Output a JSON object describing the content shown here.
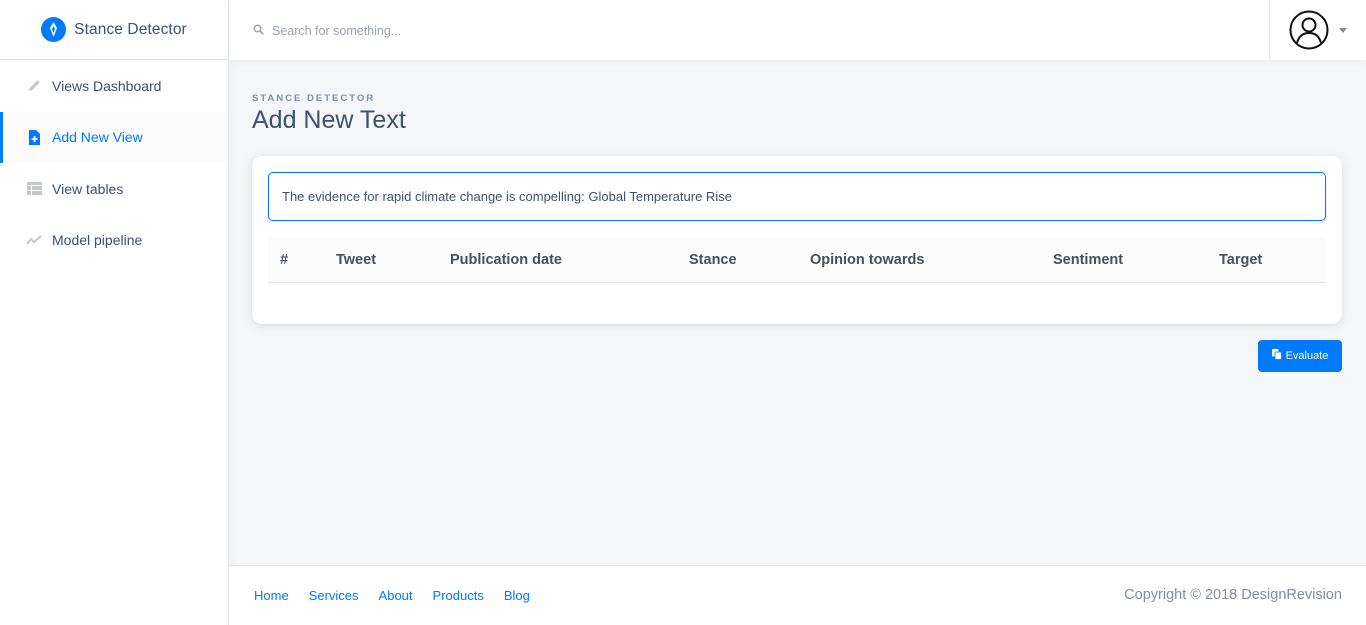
{
  "brand": {
    "name": "Stance Detector",
    "logo_icon": "flame-icon",
    "color": "#007bff"
  },
  "sidebar": {
    "items": [
      {
        "label": "Views Dashboard",
        "icon": "pencil-icon",
        "active": false
      },
      {
        "label": "Add New View",
        "icon": "note-add-icon",
        "active": true
      },
      {
        "label": "View tables",
        "icon": "table-icon",
        "active": false
      },
      {
        "label": "Model pipeline",
        "icon": "chart-line-icon",
        "active": false
      }
    ]
  },
  "topbar": {
    "search": {
      "placeholder": "Search for something...",
      "value": ""
    },
    "user": {
      "avatar_icon": "user-avatar-icon",
      "dropdown_icon": "caret-down-icon"
    }
  },
  "page": {
    "subtitle": "Stance Detector",
    "title": "Add New Text"
  },
  "editor": {
    "text_value": "The evidence for rapid climate change is compelling: Global Temperature Rise"
  },
  "table": {
    "columns": [
      "#",
      "Tweet",
      "Publication date",
      "Stance",
      "Opinion towards",
      "Sentiment",
      "Target"
    ],
    "rows": []
  },
  "actions": {
    "evaluate_label": "Evaluate",
    "evaluate_icon": "copy-icon"
  },
  "footer": {
    "links": [
      "Home",
      "Services",
      "About",
      "Products",
      "Blog"
    ],
    "copyright": "Copyright © 2018 DesignRevision"
  },
  "colors": {
    "accent": "#007bff",
    "text": "#3d5170",
    "muted": "#818ea3"
  }
}
